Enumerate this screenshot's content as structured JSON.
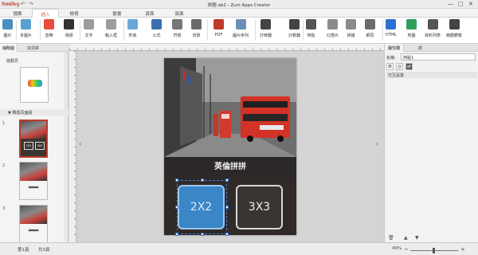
{
  "titlebar": {
    "app_logo": "Smiley",
    "title": "拼圖 ab2 - Zuni Apps Creator",
    "undo": "↶",
    "redo": "↷",
    "minimize": "—",
    "maximize": "□",
    "close": "✕"
  },
  "menu": {
    "tabs": [
      "檔案",
      "插入",
      "檢視",
      "動畫",
      "頁面",
      "頁面"
    ],
    "active_index": 1,
    "help": "?"
  },
  "ribbon": {
    "buttons": [
      {
        "label": "圖片",
        "icon": "image-icon",
        "color": "#4a90c2"
      },
      {
        "label": "多圖片",
        "icon": "multi-image-icon",
        "color": "#5aa0d0"
      },
      {
        "label": "音樂",
        "icon": "music-icon",
        "color": "#e84c3d"
      },
      {
        "label": "視頻",
        "icon": "video-icon",
        "color": "#333333"
      },
      {
        "label": "文字",
        "icon": "text-icon",
        "color": "#9c9c9c"
      },
      {
        "label": "輸入框",
        "icon": "input-box-icon",
        "color": "#9c9c9c"
      },
      {
        "label": "形狀",
        "icon": "shape-icon",
        "color": "#6aa7d8"
      },
      {
        "label": "公式",
        "icon": "formula-icon",
        "color": "#3b6fb0"
      },
      {
        "label": "符號",
        "icon": "symbol-icon",
        "color": "#777777"
      },
      {
        "label": "背景",
        "icon": "background-icon",
        "color": "#6b6b6b"
      },
      {
        "label": "PDF",
        "icon": "pdf-icon",
        "color": "#c0392b"
      },
      {
        "label": "圖片序列",
        "icon": "image-sequence-icon",
        "color": "#6b8fb8"
      },
      {
        "label": "計時器",
        "icon": "timer-icon",
        "color": "#444444"
      },
      {
        "label": "計數器",
        "icon": "counter-icon",
        "color": "#444444"
      },
      {
        "label": "熱點",
        "icon": "hotspot-icon",
        "color": "#555555"
      },
      {
        "label": "幻燈片",
        "icon": "slideshow-icon",
        "color": "#8a8a8a"
      },
      {
        "label": "掃描",
        "icon": "scan-icon",
        "color": "#8a8a8a"
      },
      {
        "label": "網頁",
        "icon": "webpage-icon",
        "color": "#6b6b6b"
      },
      {
        "label": "HTML",
        "icon": "html-icon",
        "color": "#2d6fd3"
      },
      {
        "label": "地圖",
        "icon": "map-icon",
        "color": "#2f9e5b"
      },
      {
        "label": "資料列表",
        "icon": "data-list-icon",
        "color": "#555555"
      },
      {
        "label": "簡體轉繁",
        "icon": "convert-icon",
        "color": "#444444"
      }
    ]
  },
  "left_panel": {
    "tabs": [
      "縮略圖",
      "資源庫"
    ],
    "active_tab": 0,
    "cover_label": "啟動頁",
    "group_label": "▼ 轉換頁面組",
    "pages": [
      {
        "num": "1",
        "selected": true,
        "light": false,
        "btn_a": "2X2",
        "btn_b": "3X3"
      },
      {
        "num": "2",
        "selected": false,
        "light": true,
        "btn_a": "",
        "btn_b": ""
      },
      {
        "num": "3",
        "selected": false,
        "light": true,
        "btn_a": "",
        "btn_b": ""
      }
    ]
  },
  "canvas": {
    "caption": "英倫拼拼",
    "button_a": "2X2",
    "button_b": "3X3",
    "prev": "‹",
    "next": "›"
  },
  "right_panel": {
    "tabs": [
      "屬性欄",
      "層"
    ],
    "active_tab": 0,
    "name_label": "名稱:",
    "name_value": "熱點1",
    "tool_icons": [
      "gear-icon",
      "target-icon",
      "link-icon"
    ],
    "section_title": "交互設置",
    "bottom_icons": [
      "delete-icon",
      "up-icon",
      "down-icon"
    ]
  },
  "status": {
    "page_current": "第1頁",
    "page_total": "共3頁",
    "zoom": "49%",
    "zoom_fraction": 0.49
  }
}
